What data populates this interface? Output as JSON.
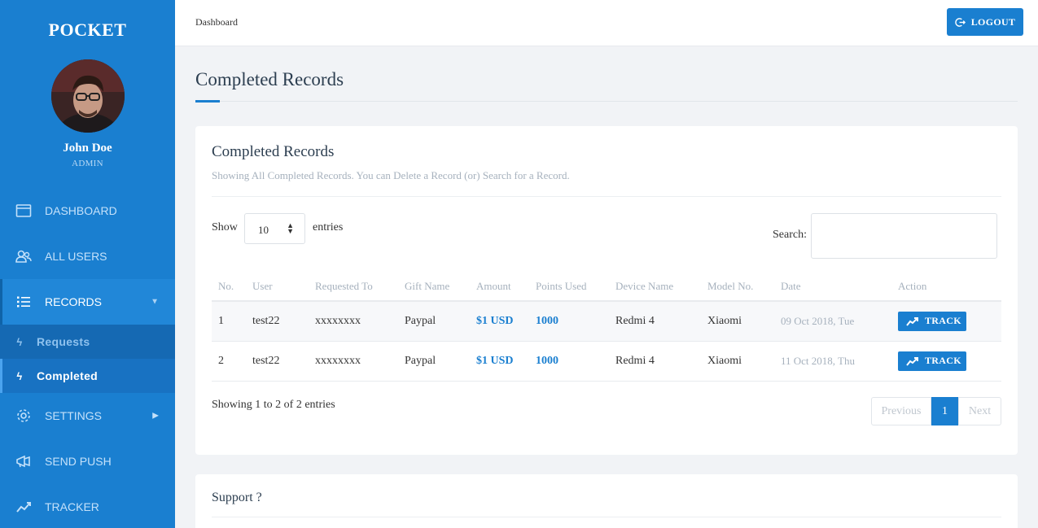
{
  "sidebar": {
    "brand": "POCKET",
    "user": {
      "name": "John Doe",
      "role": "ADMIN"
    },
    "items": [
      {
        "label": "DASHBOARD",
        "icon": "browser-window-icon"
      },
      {
        "label": "ALL USERS",
        "icon": "users-icon"
      },
      {
        "label": "RECORDS",
        "icon": "list-icon"
      },
      {
        "label": "SETTINGS",
        "icon": "gear-icon"
      },
      {
        "label": "SEND PUSH",
        "icon": "megaphone-icon"
      },
      {
        "label": "TRACKER",
        "icon": "trend-line-icon"
      }
    ],
    "subitems": [
      {
        "label": "Requests",
        "icon": "bolt-icon"
      },
      {
        "label": "Completed",
        "icon": "bolt-icon"
      }
    ]
  },
  "topbar": {
    "breadcrumb": "Dashboard",
    "logout_label": "LOGOUT"
  },
  "page": {
    "title": "Completed Records"
  },
  "card": {
    "title": "Completed Records",
    "subtitle": "Showing All Completed Records. You can Delete a Record (or) Search for a Record.",
    "show_label": "Show",
    "show_value": "10",
    "entries_label": "entries",
    "search_label": "Search:",
    "search_value": ""
  },
  "table": {
    "headers": [
      "No.",
      "User",
      "Requested To",
      "Gift Name",
      "Amount",
      "Points Used",
      "Device Name",
      "Model No.",
      "Date",
      "Action"
    ],
    "rows": [
      {
        "no": "1",
        "user": "test22",
        "requested_to": "xxxxxxxx",
        "gift": "Paypal",
        "amount": "$1 USD",
        "points": "1000",
        "device": "Redmi 4",
        "model": "Xiaomi",
        "date": "09 Oct 2018, Tue",
        "action": "TRACK"
      },
      {
        "no": "2",
        "user": "test22",
        "requested_to": "xxxxxxxx",
        "gift": "Paypal",
        "amount": "$1 USD",
        "points": "1000",
        "device": "Redmi 4",
        "model": "Xiaomi",
        "date": "11 Oct 2018, Thu",
        "action": "TRACK"
      }
    ]
  },
  "footer": {
    "info": "Showing 1 to 2 of 2 entries",
    "prev": "Previous",
    "current": "1",
    "next": "Next"
  },
  "support": {
    "title": "Support ?"
  },
  "colors": {
    "primary": "#1a7fd0",
    "sidebar_sub": "#1569b3",
    "background": "#f1f3f6"
  }
}
